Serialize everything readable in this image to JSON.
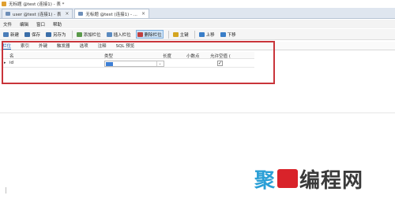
{
  "window": {
    "title": "无标题 @test (连接1) - 表 *"
  },
  "tabs": [
    {
      "label": "user @test (连接1) - 表",
      "close": "×"
    },
    {
      "label": "无标题 @test (连接1) - ...",
      "close": "×"
    }
  ],
  "menu": [
    "文件",
    "编辑",
    "窗口",
    "帮助"
  ],
  "toolbar": [
    {
      "label": "新建",
      "icon": "new-icon",
      "color": "#4a7db8"
    },
    {
      "label": "保存",
      "icon": "save-icon",
      "color": "#3b6ea8"
    },
    {
      "label": "另存为",
      "icon": "save-as-icon",
      "color": "#3b6ea8"
    },
    {
      "label": "添加栏位",
      "icon": "add-column-icon",
      "color": "#5a9a4a"
    },
    {
      "label": "插入栏位",
      "icon": "insert-column-icon",
      "color": "#5a8ac0"
    },
    {
      "label": "删除栏位",
      "icon": "delete-column-icon",
      "color": "#c04040"
    },
    {
      "label": "主键",
      "icon": "key-icon",
      "color": "#d4a520"
    },
    {
      "label": "上移",
      "icon": "arrow-up-icon",
      "color": "#3a7ec8"
    },
    {
      "label": "下移",
      "icon": "arrow-down-icon",
      "color": "#3a7ec8"
    }
  ],
  "subtabs": [
    "栏位",
    "索引",
    "外键",
    "触发器",
    "选项",
    "注释",
    "SQL 预览"
  ],
  "grid": {
    "headers": {
      "name": "名",
      "type": "类型",
      "length": "长度",
      "decimals": "小数点",
      "allow_null": "允许空值 ("
    },
    "row": {
      "marker": "▸",
      "name": "id",
      "type_arrow": "⌄",
      "allow_null_check": "✓"
    }
  },
  "watermark": {
    "part1": "聚",
    "part2": "编程网"
  },
  "colors": {
    "highlight": "#c9343a",
    "tab_bg": "#dfe6ef"
  }
}
